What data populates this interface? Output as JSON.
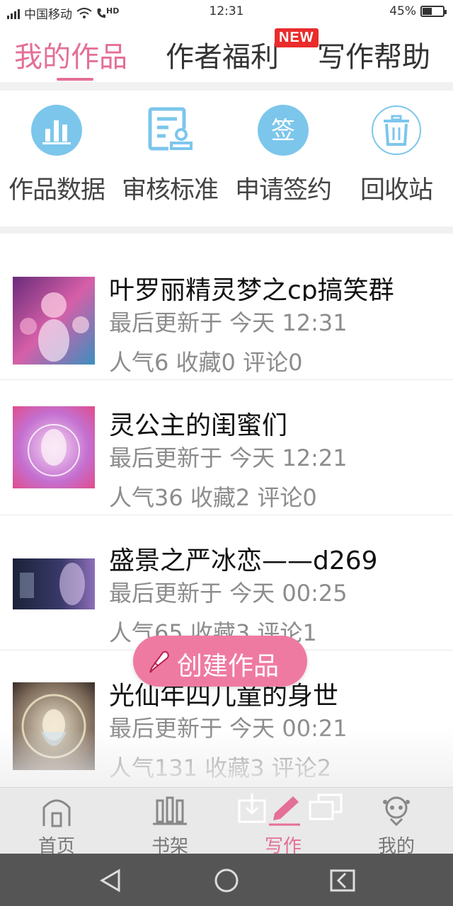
{
  "status_bar": {
    "carrier": "中国移动",
    "network_label": "HD",
    "time": "12:31",
    "battery": "45%",
    "battery_level": 0.45
  },
  "tabs": [
    {
      "label": "我的作品",
      "active": true
    },
    {
      "label": "作者福利",
      "active": false,
      "badge": "NEW"
    },
    {
      "label": "写作帮助",
      "active": false
    }
  ],
  "quick_actions": [
    {
      "label": "作品数据",
      "icon": "bar-chart-icon"
    },
    {
      "label": "审核标准",
      "icon": "review-document-icon"
    },
    {
      "label": "申请签约",
      "icon": "sign-contract-icon",
      "icon_text": "签"
    },
    {
      "label": "回收站",
      "icon": "trash-icon"
    }
  ],
  "works": [
    {
      "title": "叶罗丽精灵梦之cp搞笑群",
      "updated": "最后更新于 今天 12:31",
      "stats": "人气6 收藏0 评论0"
    },
    {
      "title": "灵公主的闺蜜们",
      "updated": "最后更新于 今天 12:21",
      "stats": "人气36 收藏2 评论0"
    },
    {
      "title": "盛景之严冰恋——d269",
      "updated": "最后更新于 今天 00:25",
      "stats": "人气65 收藏3 评论1"
    },
    {
      "title": "光仙年四儿童的身世",
      "updated": "最后更新于 今天 00:21",
      "stats": "人气131 收藏3 评论2"
    }
  ],
  "fab": {
    "label": "创建作品",
    "icon": "pencil-icon"
  },
  "bottom_nav": [
    {
      "label": "首页",
      "icon": "home-icon",
      "active": false
    },
    {
      "label": "书架",
      "icon": "bookshelf-icon",
      "active": false
    },
    {
      "label": "写作",
      "icon": "write-pen-icon",
      "active": true
    },
    {
      "label": "我的",
      "icon": "profile-icon",
      "active": false
    }
  ],
  "colors": {
    "accent": "#e46f97",
    "fab": "#ef7aa1",
    "icon_blue": "#7cc6ec",
    "new_badge": "#ea2c2c",
    "text_gray": "#8c8c8c"
  }
}
